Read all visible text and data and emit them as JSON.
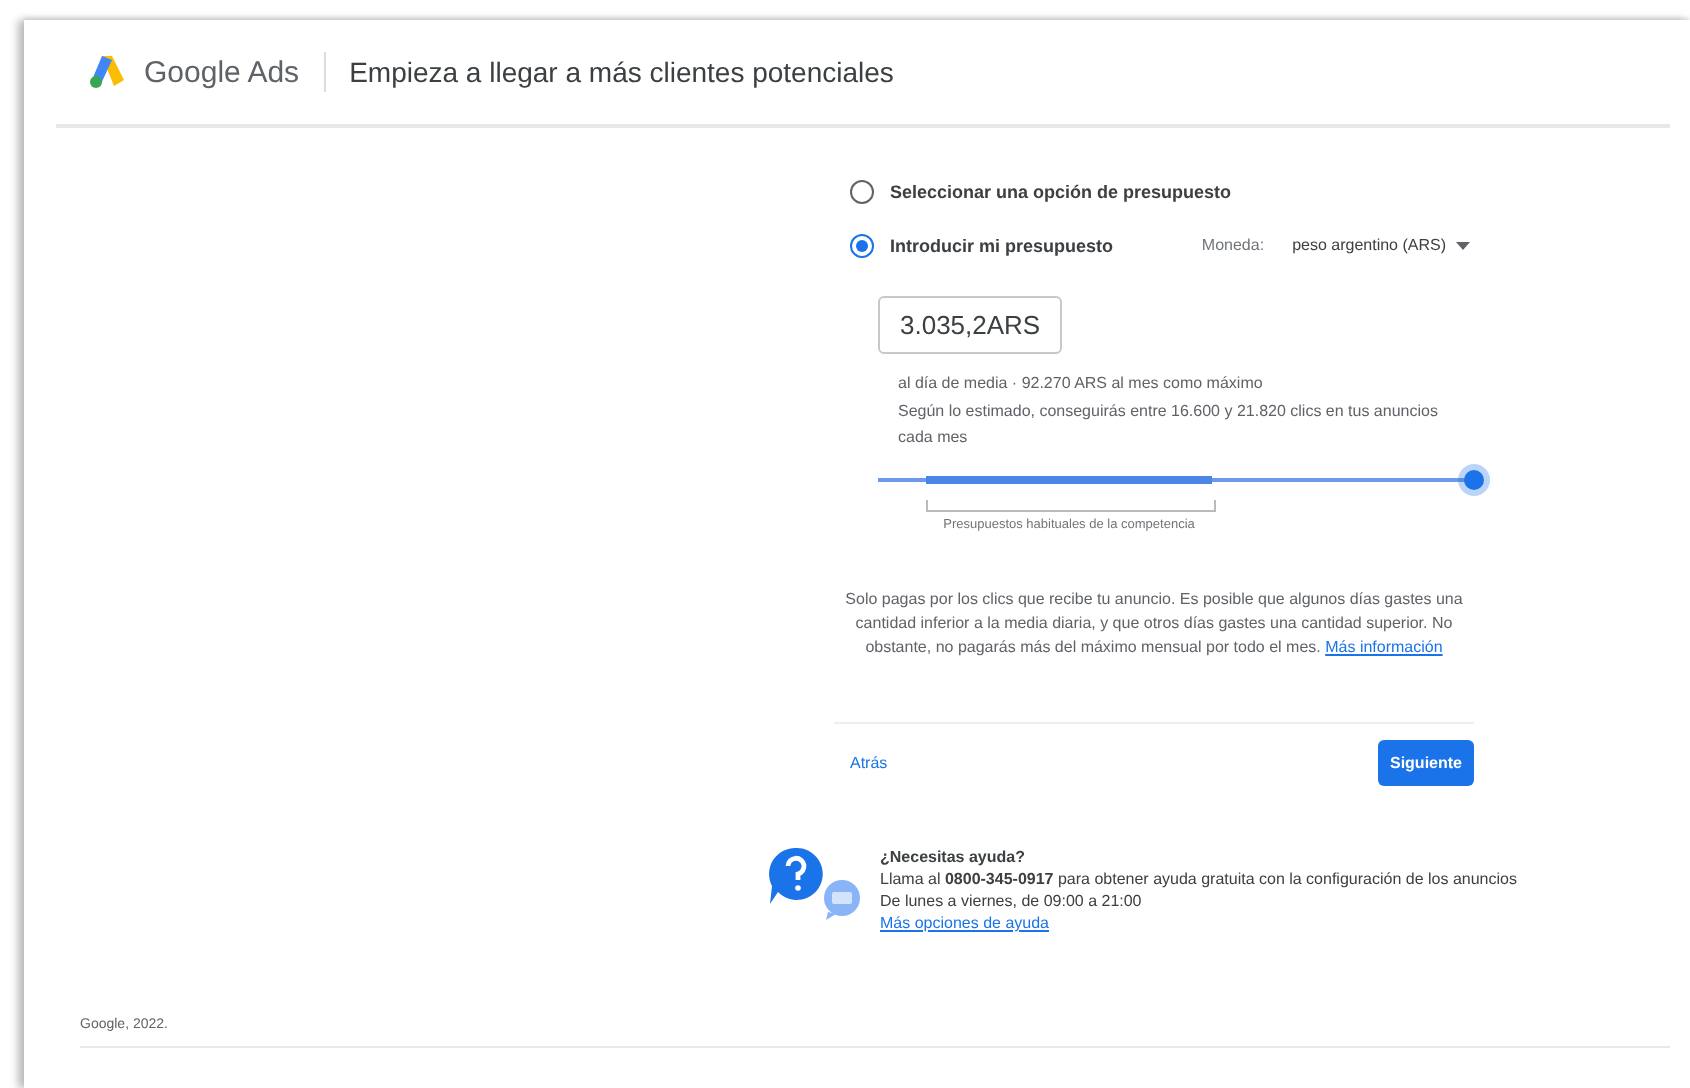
{
  "header": {
    "product": "Google Ads",
    "title": "Empieza a llegar a más clientes potenciales"
  },
  "budget_options": [
    {
      "label": "Seleccionar una opción de presupuesto",
      "selected": false
    },
    {
      "label": "Introducir mi presupuesto",
      "selected": true
    }
  ],
  "currency": {
    "label": "Moneda:",
    "value": "peso argentino (ARS)"
  },
  "budget": {
    "value": "3.035,2ARS",
    "daily_note": "al día de media",
    "separator": "·",
    "monthly_note": "92.270 ARS al mes como máximo",
    "estimate": "Según lo estimado, conseguirás entre 16.600 y 21.820 clics en tus anuncios cada mes",
    "slider": {
      "level": 1
    },
    "range_label": "Presupuestos habituales de la competencia"
  },
  "info": {
    "text": "Solo pagas por los clics que recibe tu anuncio. Es posible que algunos días gastes una cantidad inferior a la media diaria, y que otros días gastes una cantidad superior. No obstante, no pagarás más del máximo mensual por todo el mes.",
    "link": "Más información"
  },
  "nav": {
    "back": "Atrás",
    "next": "Siguiente"
  },
  "help": {
    "title": "¿Necesitas ayuda?",
    "phone_line": "Llama al **0800-345-0917** para obtener ayuda gratuita con la configuración de los anuncios",
    "hours": "De lunes a viernes, de 09:00 a 21:00",
    "link": "Más opciones de ayuda"
  },
  "footer": "Google, 2022."
}
